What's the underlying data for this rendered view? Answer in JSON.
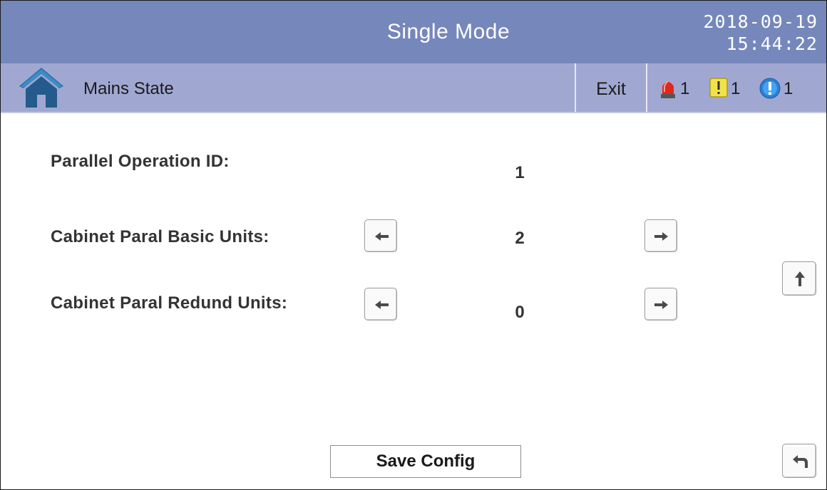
{
  "header": {
    "title": "Single Mode",
    "date": "2018-09-19",
    "time": "15:44:22"
  },
  "subheader": {
    "page": "Mains State",
    "exit_label": "Exit",
    "alarms": [
      {
        "icon": "red-beacon-icon",
        "count": "1"
      },
      {
        "icon": "yellow-warning-icon",
        "count": "1"
      },
      {
        "icon": "blue-info-icon",
        "count": "1"
      }
    ]
  },
  "settings": {
    "parallel_id": {
      "label": "Parallel Operation ID:",
      "value": "1"
    },
    "basic_units": {
      "label": "Cabinet Paral Basic Units:",
      "value": "2"
    },
    "redund_units": {
      "label": "Cabinet Paral Redund Units:",
      "value": "0"
    }
  },
  "footer": {
    "save_label": "Save Config"
  },
  "colors": {
    "title_bar": "#7587bb",
    "sub_bar": "#a0a8d2",
    "home_icon": "#255a8c"
  }
}
